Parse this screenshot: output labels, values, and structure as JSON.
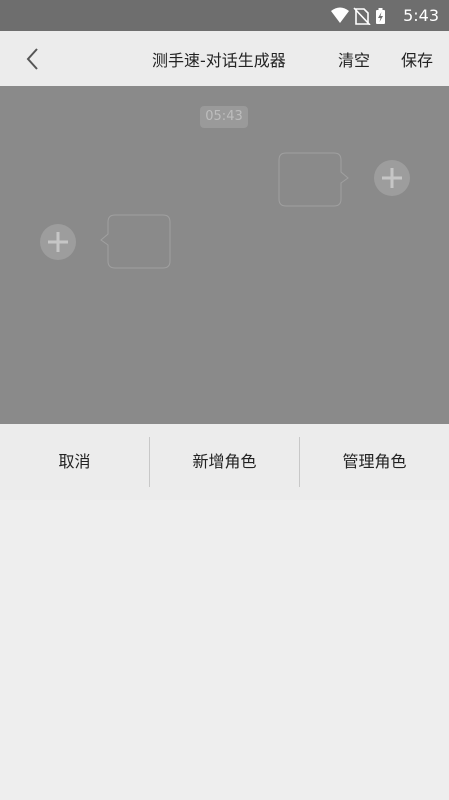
{
  "status_bar": {
    "time": "5:43",
    "icons": [
      "wifi-icon",
      "no-sim-icon",
      "battery-charging-icon"
    ]
  },
  "toolbar": {
    "title": "测手速-对话生成器",
    "clear_label": "清空",
    "save_label": "保存",
    "back_icon": "chevron-left-icon"
  },
  "chat_canvas": {
    "timestamp": "05:43"
  },
  "actions": {
    "cancel_label": "取消",
    "add_role_label": "新增角色",
    "manage_roles_label": "管理角色"
  },
  "colors": {
    "status_bar": "#6e6e6e",
    "toolbar": "#ececec",
    "canvas": "#8a8a8a",
    "panel": "#eeeeee"
  }
}
